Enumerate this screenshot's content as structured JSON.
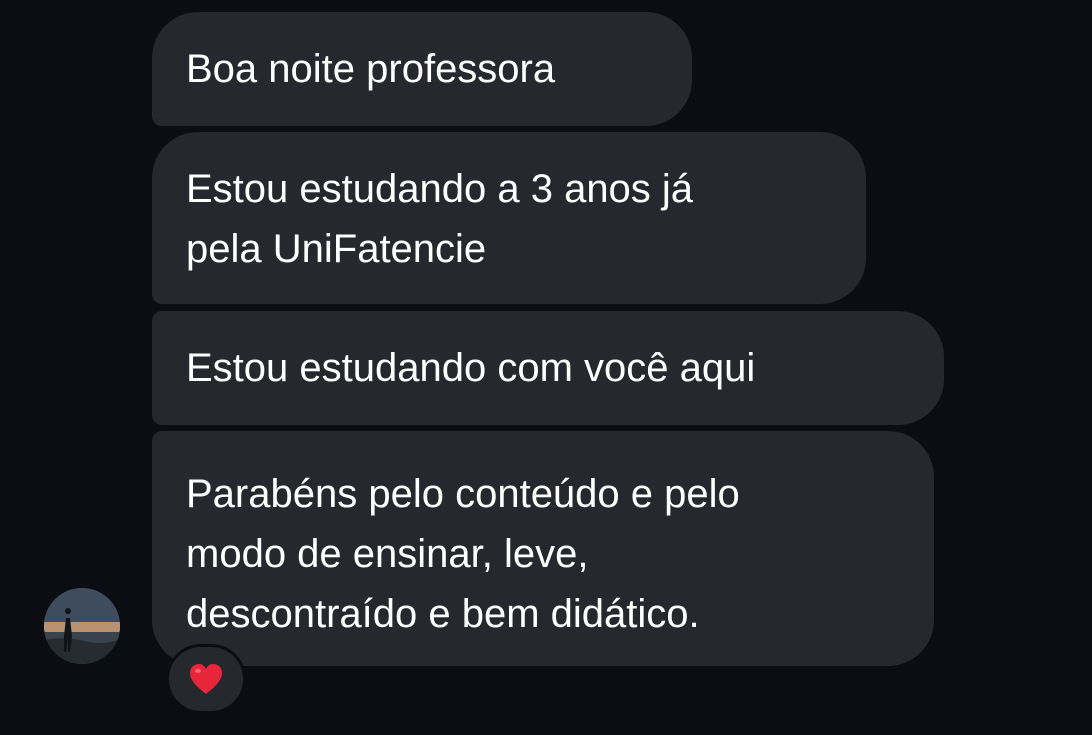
{
  "messages": [
    {
      "lines": [
        "Boa noite professora"
      ]
    },
    {
      "lines": [
        "Estou estudando a 3 anos já",
        "pela UniFatencie"
      ]
    },
    {
      "lines": [
        "Estou estudando com você aqui"
      ]
    },
    {
      "lines": [
        "Parabéns pelo conteúdo e pelo",
        "modo de ensinar, leve,",
        "descontraído e bem didático."
      ]
    }
  ],
  "reaction": {
    "icon": "heart-icon",
    "color": "#e8263b"
  },
  "avatar": {
    "icon": "profile-photo"
  },
  "colors": {
    "background": "#0b0d12",
    "bubble": "#26282d",
    "text": "#ffffff"
  }
}
